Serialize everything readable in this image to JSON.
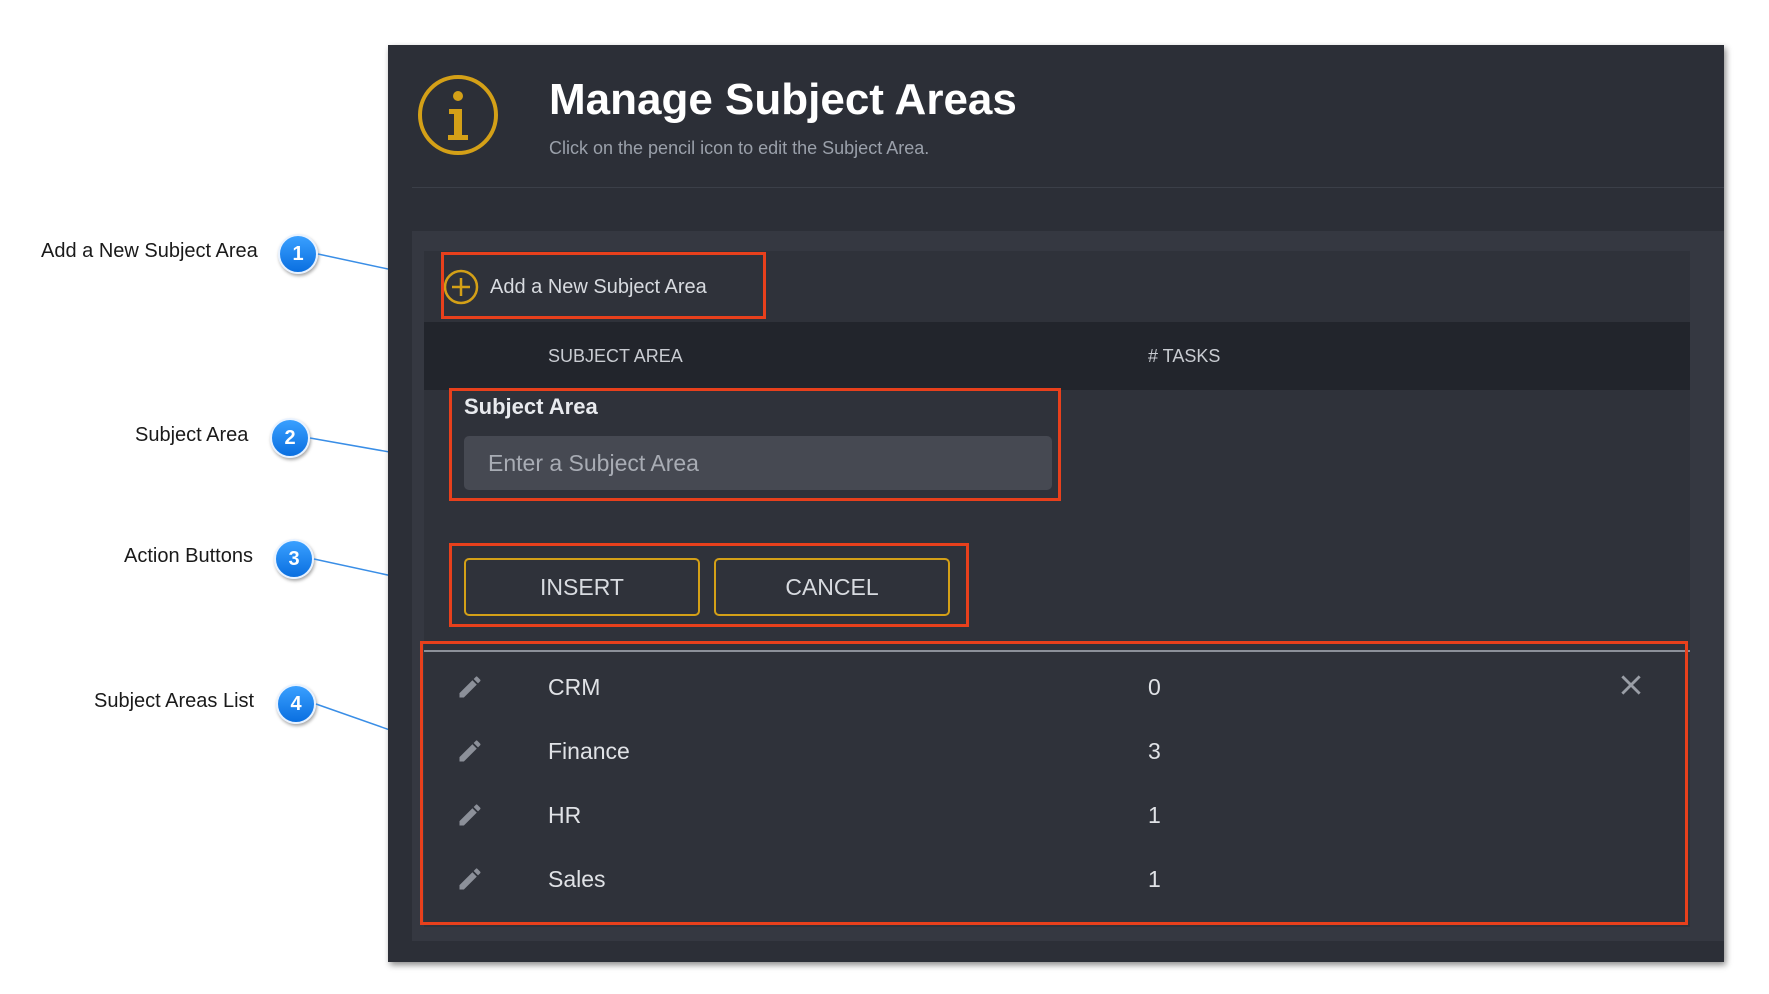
{
  "callouts": [
    {
      "number": "1",
      "label": "Add a New Subject Area"
    },
    {
      "number": "2",
      "label": "Subject  Area"
    },
    {
      "number": "3",
      "label": "Action Buttons"
    },
    {
      "number": "4",
      "label": "Subject Areas List"
    }
  ],
  "header": {
    "title": "Manage Subject Areas",
    "subtitle": "Click on the pencil icon to edit the Subject Area."
  },
  "add_new": {
    "label": "Add a New Subject Area"
  },
  "table": {
    "columns": {
      "subject_area": "SUBJECT AREA",
      "tasks": "# TASKS"
    },
    "rows": [
      {
        "name": "CRM",
        "tasks": "0"
      },
      {
        "name": "Finance",
        "tasks": "3"
      },
      {
        "name": "HR",
        "tasks": "1"
      },
      {
        "name": "Sales",
        "tasks": "1"
      }
    ]
  },
  "form": {
    "field_label": "Subject Area",
    "placeholder": "Enter a Subject Area",
    "value": "",
    "insert_label": "INSERT",
    "cancel_label": "CANCEL"
  },
  "icons": {
    "info": "info-icon",
    "add": "plus-circle-icon",
    "edit": "pencil-icon",
    "delete": "close-icon"
  },
  "colors": {
    "panel_bg": "#2c2f37",
    "accent_gold": "#d4a017",
    "highlight_red": "#e8401c",
    "callout_blue": "#1a86f5"
  }
}
